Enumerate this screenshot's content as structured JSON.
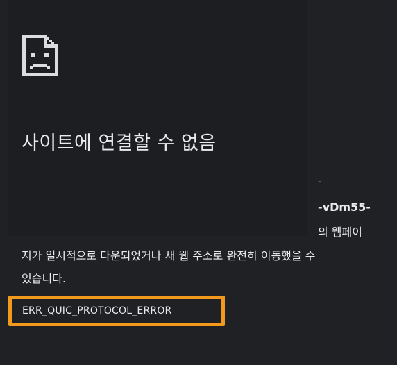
{
  "icon": "sad-page-icon",
  "title": "사이트에 연결할 수 없음",
  "fragments": [
    "-",
    "-vDm55-",
    "의 웹페이"
  ],
  "body": {
    "line1": "지가 일시적으로 다운되었거나 새 웹 주소로 완전히 이동했을 수",
    "line2": "있습니다."
  },
  "error_code": "ERR_QUIC_PROTOCOL_ERROR",
  "colors": {
    "background": "#202124",
    "text": "#e8eaed",
    "highlight": "#f39a1c"
  }
}
